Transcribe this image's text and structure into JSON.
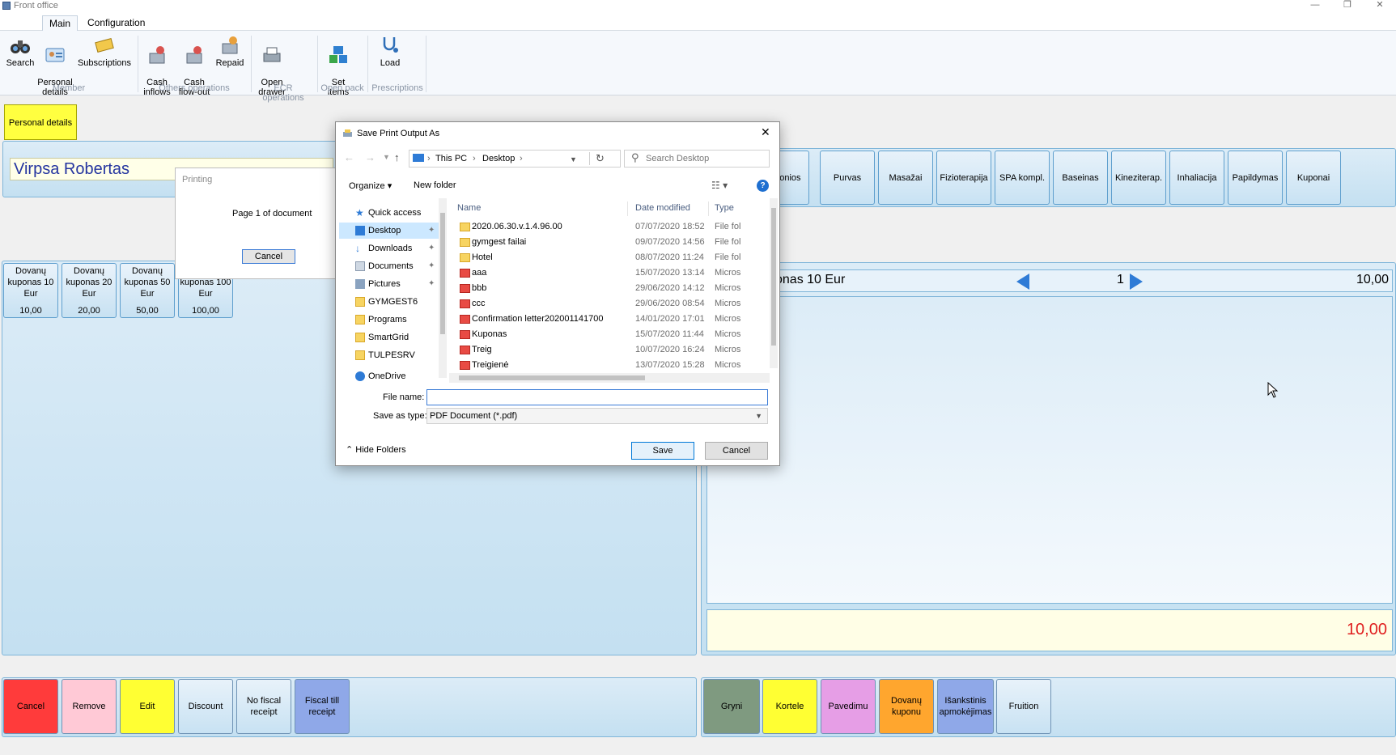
{
  "window": {
    "title": "Front office"
  },
  "ribbon": {
    "tabs": [
      {
        "label": "Main"
      },
      {
        "label": "Configuration"
      }
    ],
    "buttons": {
      "search": "Search",
      "personal": "Personal\ndetails",
      "subscriptions": "Subscriptions",
      "cash_in": "Cash\ninflows",
      "cash_out": "Cash\nflow-out",
      "repaid": "Repaid",
      "open_drawer": "Open\ndrawer",
      "set_items": "Set\nitems",
      "load": "Load"
    },
    "groups": {
      "member": "Member",
      "others": "Others operations",
      "ecr": "ECR operations",
      "open_pack": "Open pack",
      "prescriptions": "Prescriptions"
    }
  },
  "left": {
    "personal_tab": "Personal details",
    "member_name": "Virpsa Robertas",
    "vouchers": [
      {
        "label": "Dovanų kuponas 10 Eur",
        "price": "10,00"
      },
      {
        "label": "Dovanų kuponas 20 Eur",
        "price": "20,00"
      },
      {
        "label": "Dovanų kuponas 50 Eur",
        "price": "50,00"
      },
      {
        "label": "kuponas 100 Eur",
        "price": "100,00"
      }
    ]
  },
  "services": [
    "Vonios",
    "Purvas",
    "Masažai",
    "Fizioterapija",
    "SPA kompl.",
    "Baseinas",
    "Kineziterap.",
    "Inhaliacija",
    "Papildymas",
    "Kuponai"
  ],
  "receipt": {
    "item": "onas 10 Eur",
    "page": "1",
    "amount": "10,00",
    "total": "10,00"
  },
  "actions_left": [
    "Cancel",
    "Remove",
    "Edit",
    "Discount",
    "No fiscal\nreceipt",
    "Fiscal till\nreceipt"
  ],
  "actions_right": [
    "Gryni",
    "Kortele",
    "Pavedimu",
    "Dovanų\nkuponu",
    "Išankstinis\napmokėjimas",
    "Fruition"
  ],
  "colors": {
    "cancel": "#ff3b3b",
    "remove": "#ffc9d6",
    "edit": "#ffff33",
    "gryni": "#7f9a80",
    "kortele": "#ffff33",
    "pavedimu": "#e69ee6",
    "dovanu": "#ffa62e",
    "isankstinis": "#8fa8e8",
    "blue": "#2e7bd6"
  },
  "printing": {
    "title": "Printing",
    "message": "Page 1 of document",
    "cancel": "Cancel"
  },
  "save_dialog": {
    "title": "Save Print Output As",
    "breadcrumb": [
      "This PC",
      "Desktop"
    ],
    "search_placeholder": "Search Desktop",
    "organize": "Organize",
    "new_folder": "New folder",
    "nav": [
      {
        "label": "Quick access",
        "icon": "star-icon"
      },
      {
        "label": "Desktop",
        "icon": "desktop-icon"
      },
      {
        "label": "Downloads",
        "icon": "download-icon"
      },
      {
        "label": "Documents",
        "icon": "document-icon"
      },
      {
        "label": "Pictures",
        "icon": "picture-icon"
      },
      {
        "label": "GYMGEST6",
        "icon": "folder-icon"
      },
      {
        "label": "Programs",
        "icon": "folder-icon"
      },
      {
        "label": "SmartGrid",
        "icon": "folder-icon"
      },
      {
        "label": "TULPESRV",
        "icon": "folder-icon"
      },
      {
        "label": "OneDrive",
        "icon": "cloud-icon"
      }
    ],
    "columns": {
      "name": "Name",
      "date": "Date modified",
      "type": "Type"
    },
    "files": [
      {
        "name": "2020.06.30.v.1.4.96.00",
        "date": "07/07/2020 18:52",
        "type": "File fol",
        "kind": "folder"
      },
      {
        "name": "gymgest failai",
        "date": "09/07/2020 14:56",
        "type": "File fol",
        "kind": "folder"
      },
      {
        "name": "Hotel",
        "date": "08/07/2020 11:24",
        "type": "File fol",
        "kind": "folder"
      },
      {
        "name": "aaa",
        "date": "15/07/2020 13:14",
        "type": "Micros",
        "kind": "pdf"
      },
      {
        "name": "bbb",
        "date": "29/06/2020 14:12",
        "type": "Micros",
        "kind": "pdf"
      },
      {
        "name": "ccc",
        "date": "29/06/2020 08:54",
        "type": "Micros",
        "kind": "pdf"
      },
      {
        "name": "Confirmation letter202001141700",
        "date": "14/01/2020 17:01",
        "type": "Micros",
        "kind": "pdf"
      },
      {
        "name": "Kuponas",
        "date": "15/07/2020 11:44",
        "type": "Micros",
        "kind": "pdf"
      },
      {
        "name": "Treig",
        "date": "10/07/2020 16:24",
        "type": "Micros",
        "kind": "pdf"
      },
      {
        "name": "Treigienė",
        "date": "13/07/2020 15:28",
        "type": "Micros",
        "kind": "pdf"
      }
    ],
    "file_name_label": "File name:",
    "file_name_value": "",
    "save_type_label": "Save as type:",
    "save_type_value": "PDF Document (*.pdf)",
    "save": "Save",
    "cancel": "Cancel",
    "hide_folders": "Hide Folders"
  }
}
